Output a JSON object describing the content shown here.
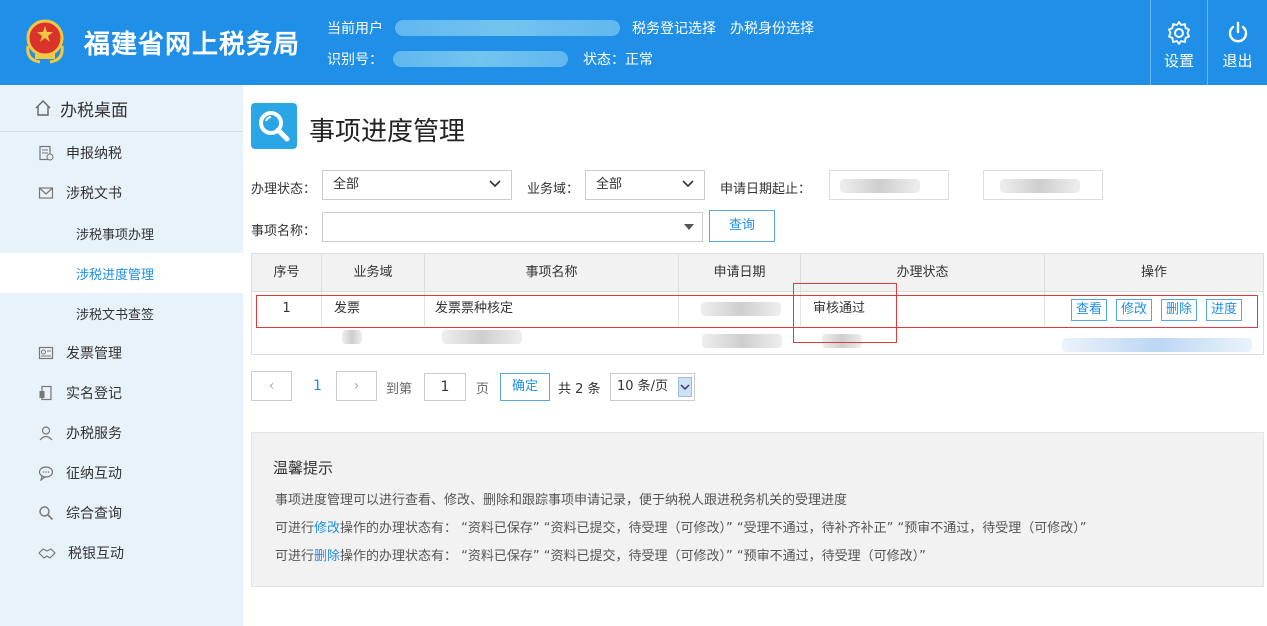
{
  "header": {
    "site_title": "福建省网上税务局",
    "current_user_label": "当前用户",
    "links": [
      "税务登记选择",
      "办税身份选择"
    ],
    "id_label": "识别号：",
    "status_label": "状态：正常",
    "settings_label": "设置",
    "logout_label": "退出"
  },
  "sidebar": {
    "home": "办税桌面",
    "items": [
      {
        "label": "申报纳税",
        "icon": "tax-report-icon"
      },
      {
        "label": "涉税文书",
        "icon": "mail-icon"
      },
      {
        "label": "发票管理",
        "icon": "invoice-icon"
      },
      {
        "label": "实名登记",
        "icon": "realname-icon"
      },
      {
        "label": "办税服务",
        "icon": "service-icon"
      },
      {
        "label": "征纳互动",
        "icon": "chat-icon"
      },
      {
        "label": "综合查询",
        "icon": "search-icon"
      },
      {
        "label": "税银互动",
        "icon": "handshake-icon"
      }
    ],
    "subitems": [
      "涉税事项办理",
      "涉税进度管理",
      "涉税文书查签"
    ],
    "active_subitem": "涉税进度管理"
  },
  "page": {
    "title": "事项进度管理"
  },
  "filters": {
    "status_label": "办理状态：",
    "status_value": "全部",
    "domain_label": "业务域：",
    "domain_value": "全部",
    "date_label": "申请日期起止：",
    "item_label": "事项名称：",
    "query_button": "查询"
  },
  "table": {
    "headers": [
      "序号",
      "业务域",
      "事项名称",
      "申请日期",
      "办理状态",
      "操作"
    ],
    "rows": [
      {
        "index": "1",
        "domain": "发票",
        "item": "发票票种核定",
        "status": "审核通过"
      }
    ],
    "actions": [
      "查看",
      "修改",
      "删除",
      "进度"
    ]
  },
  "pagination": {
    "prev": "‹",
    "next": "›",
    "current": "1",
    "goto_label": "到第",
    "page_input": "1",
    "page_unit": "页",
    "confirm": "确定",
    "total": "共 2 条",
    "page_size": "10 条/页"
  },
  "tips": {
    "title": "温馨提示",
    "line1": "事项进度管理可以进行查看、修改、删除和跟踪事项申请记录，便于纳税人跟进税务机关的受理进度",
    "line2_pre": "可进行",
    "line2_em": "修改",
    "line2_post": "操作的办理状态有：  “资料已保存”   “资料已提交，待受理（可修改）”   “受理不通过，待补齐补正”   “预审不通过，待受理（可修改）”",
    "line3_pre": "可进行",
    "line3_em": "删除",
    "line3_post": "操作的办理状态有：  “资料已保存”   “资料已提交，待受理（可修改）”   “预审不通过，待受理（可修改）”"
  },
  "colors": {
    "header_bg": "#1f8fe8",
    "sidebar_bg": "#e8f2fb",
    "accent": "#1f8fe8",
    "highlight_red": "#e23a3a"
  }
}
